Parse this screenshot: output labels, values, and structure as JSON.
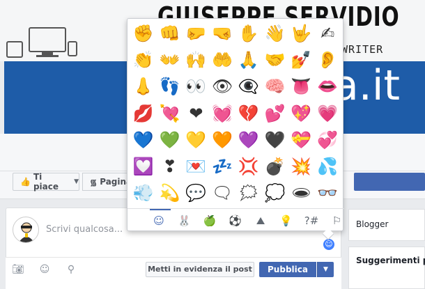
{
  "cover": {
    "title": "GIUSEPPE SERVIDIO",
    "subtitle": "WRITER",
    "brand": "a.it"
  },
  "page_actions": {
    "like_label": "Ti piace",
    "page_label": "Pagina"
  },
  "right_column": {
    "card1_label": "Blogger",
    "card2_label": "Suggerimenti p"
  },
  "composer": {
    "placeholder": "Scrivi qualcosa...",
    "highlight_label": "Metti in evidenza il post",
    "publish_label": "Pubblica"
  },
  "emoji_picker": {
    "emojis": [
      [
        "✊",
        "👊",
        "🤛",
        "🤜",
        "✋",
        "👋",
        "🤟",
        "✍"
      ],
      [
        "👏",
        "👐",
        "🙌",
        "🤲",
        "🙏",
        "🤝",
        "💅",
        "👂"
      ],
      [
        "👃",
        "👣",
        "👀",
        "👁",
        "👁‍🗨",
        "🧠",
        "👅",
        "👄"
      ],
      [
        "💋",
        "💘",
        "❤",
        "💓",
        "💔",
        "💕",
        "💖",
        "💗"
      ],
      [
        "💙",
        "💚",
        "💛",
        "🧡",
        "💜",
        "🖤",
        "💝",
        "💞"
      ],
      [
        "💟",
        "❣",
        "💌",
        "💤",
        "💢",
        "💣",
        "💥",
        "💦"
      ],
      [
        "💨",
        "💫",
        "💬",
        "🗨",
        "🗯",
        "💭",
        "🕳",
        "👓"
      ]
    ],
    "tabs": [
      {
        "icon": "smiley-icon",
        "glyph": "☺"
      },
      {
        "icon": "rabbit-icon",
        "glyph": "🐰"
      },
      {
        "icon": "apple-icon",
        "glyph": "🍏"
      },
      {
        "icon": "soccer-ball-icon",
        "glyph": "⚽"
      },
      {
        "icon": "mountain-icon",
        "glyph": "⛰"
      },
      {
        "icon": "lightbulb-icon",
        "glyph": "💡"
      },
      {
        "icon": "symbols-icon",
        "glyph": "?#"
      },
      {
        "icon": "flag-icon",
        "glyph": "⚐"
      }
    ]
  },
  "colors": {
    "facebook_blue": "#4267b2",
    "cover_band": "#1e5ca8"
  }
}
